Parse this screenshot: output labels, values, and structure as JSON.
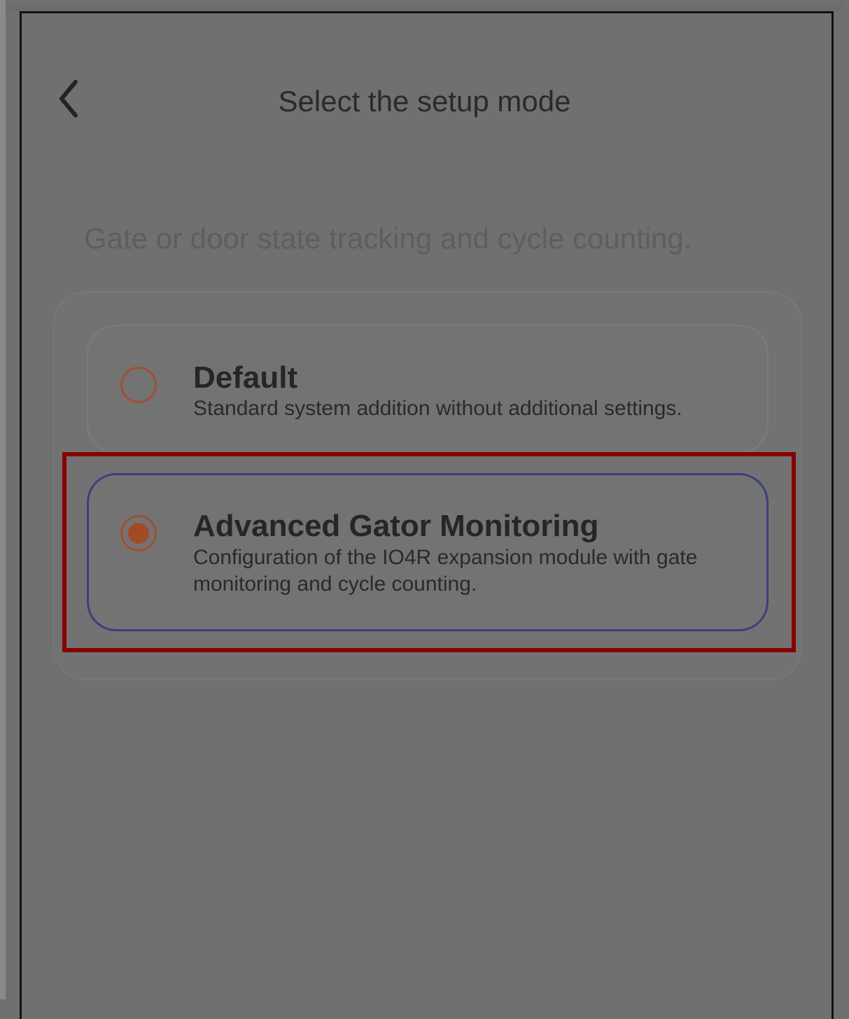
{
  "header": {
    "title": "Select the setup mode",
    "back_icon": "chevron-left-icon"
  },
  "subtitle": "Gate or door state tracking and cycle counting.",
  "options": [
    {
      "title": "Default",
      "description": "Standard system addition without additional settings.",
      "selected": false
    },
    {
      "title": "Advanced Gator Monitoring",
      "description": "Configuration of the IO4R expansion module with gate monitoring and cycle counting.",
      "selected": true
    }
  ],
  "colors": {
    "overlay_background": "#707070",
    "radio_accent": "#a24a26",
    "selected_border": "#3c3f80",
    "highlight_box": "#870000"
  }
}
